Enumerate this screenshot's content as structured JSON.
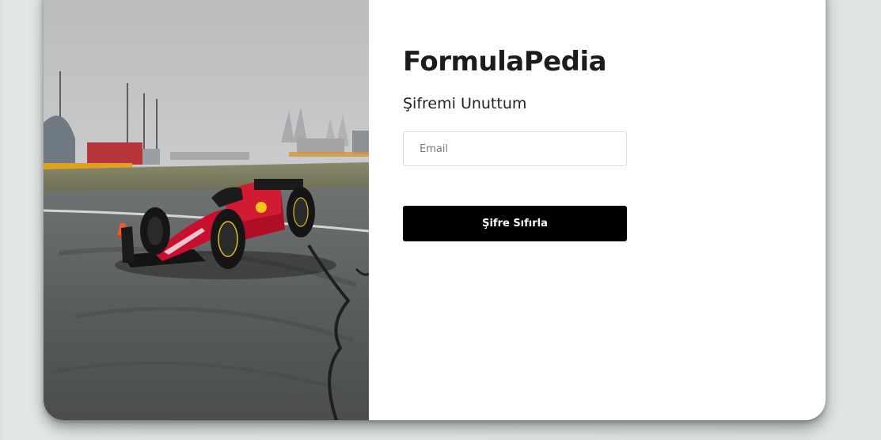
{
  "brand": {
    "title": "FormulaPedia"
  },
  "form": {
    "subtitle": "Şifremi Unuttum",
    "email_placeholder": "Email",
    "email_value": "",
    "submit_label": "Şifre Sıfırla"
  },
  "photo": {
    "icon": "formula-car-photo"
  },
  "colors": {
    "background": "#dfe3e3",
    "card": "#ffffff",
    "button": "#000000",
    "button_text": "#ffffff",
    "car_red": "#c8102e"
  }
}
